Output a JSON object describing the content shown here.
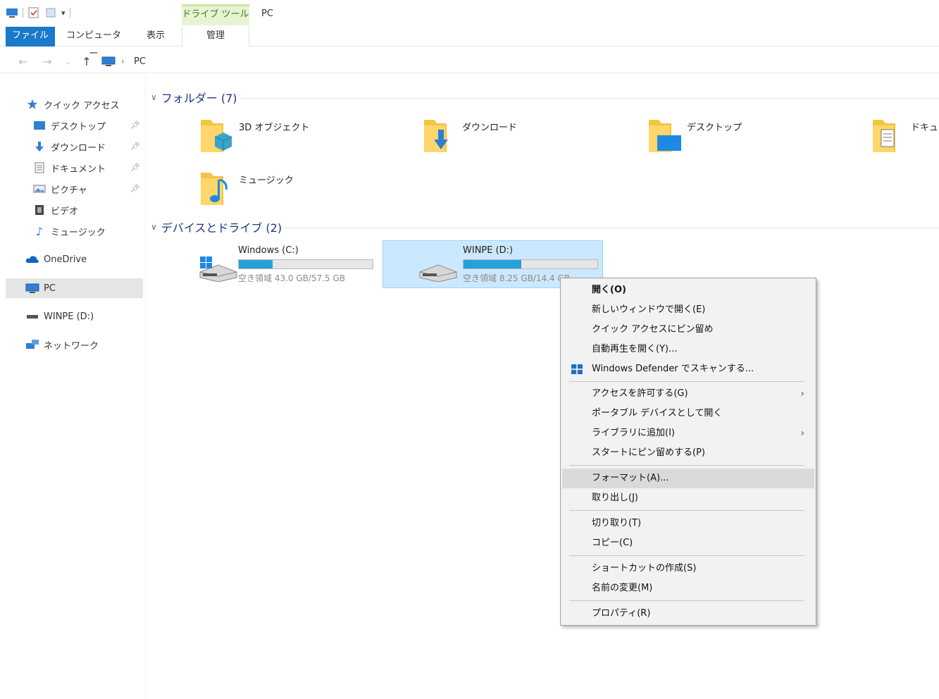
{
  "titlebar": {
    "context_tab": "ドライブ ツール",
    "title": "PC"
  },
  "ribbon": {
    "tabs": [
      {
        "label": "ファイル"
      },
      {
        "label": "コンピューター"
      },
      {
        "label": "表示"
      },
      {
        "label": "管理"
      }
    ]
  },
  "address": {
    "location": "PC"
  },
  "navpane": {
    "quick_access": "クイック アクセス",
    "pinned": [
      {
        "label": "デスクトップ"
      },
      {
        "label": "ダウンロード"
      },
      {
        "label": "ドキュメント"
      },
      {
        "label": "ピクチャ"
      }
    ],
    "others": [
      {
        "label": "ビデオ"
      },
      {
        "label": "ミュージック"
      }
    ],
    "onedrive": "OneDrive",
    "pc": "PC",
    "winpe": "WINPE (D:)",
    "network": "ネットワーク"
  },
  "folders": {
    "header": "フォルダー (7)",
    "items": [
      {
        "name": "3D オブジェクト"
      },
      {
        "name": "ダウンロード"
      },
      {
        "name": "デスクトップ"
      },
      {
        "name": "ドキュメ"
      },
      {
        "name": "ミュージック"
      }
    ]
  },
  "devices": {
    "header": "デバイスとドライブ (2)",
    "items": [
      {
        "name": "Windows (C:)",
        "free": "空き領域 43.0 GB/57.5 GB",
        "used_fraction": 0.25
      },
      {
        "name": "WINPE (D:)",
        "free": "空き領域 8.25 GB/14.4 GB",
        "used_fraction": 0.43
      }
    ]
  },
  "context_menu": {
    "items": [
      {
        "label": "開く(O)"
      },
      {
        "label": "新しいウィンドウで開く(E)"
      },
      {
        "label": "クイック アクセスにピン留め"
      },
      {
        "label": "自動再生を開く(Y)..."
      },
      {
        "label": "Windows Defender でスキャンする..."
      },
      {
        "label": "アクセスを許可する(G)"
      },
      {
        "label": "ポータブル デバイスとして開く"
      },
      {
        "label": "ライブラリに追加(I)"
      },
      {
        "label": "スタートにピン留めする(P)"
      },
      {
        "label": "フォーマット(A)..."
      },
      {
        "label": "取り出し(J)"
      },
      {
        "label": "切り取り(T)"
      },
      {
        "label": "コピー(C)"
      },
      {
        "label": "ショートカットの作成(S)"
      },
      {
        "label": "名前の変更(M)"
      },
      {
        "label": "プロパティ(R)"
      }
    ]
  },
  "colors": {
    "accent": "#1979ca",
    "header_text": "#1e3287",
    "selection": "#cce8ff",
    "drive_bar": "#26a0da",
    "context_tab": "#e7f3d3"
  }
}
